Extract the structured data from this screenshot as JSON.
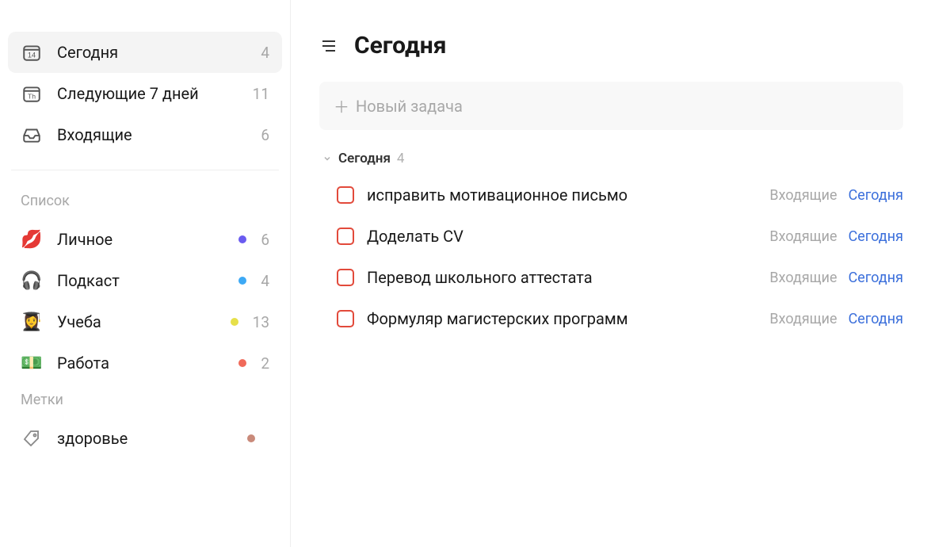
{
  "sidebar": {
    "smart": [
      {
        "icon": "calendar-today",
        "label": "Сегодня",
        "count": 4,
        "selected": true
      },
      {
        "icon": "calendar-week",
        "label": "Следующие 7 дней",
        "count": 11,
        "selected": false
      },
      {
        "icon": "inbox",
        "label": "Входящие",
        "count": 6,
        "selected": false
      }
    ],
    "lists_header": "Список",
    "lists": [
      {
        "emoji": "💋",
        "label": "Личное",
        "dot": "#6a5bf0",
        "count": 6
      },
      {
        "emoji": "🎧",
        "label": "Подкаст",
        "dot": "#3da9f5",
        "count": 4
      },
      {
        "emoji": "👩‍🎓",
        "label": "Учеба",
        "dot": "#e6e04a",
        "count": 13
      },
      {
        "emoji": "💵",
        "label": "Работа",
        "dot": "#f06a5a",
        "count": 2
      }
    ],
    "tags_header": "Метки",
    "tags": [
      {
        "icon": "tag",
        "label": "здоровье",
        "dot": "#c98a7a"
      }
    ]
  },
  "main": {
    "title": "Сегодня",
    "new_task_placeholder": "Новый задача",
    "group": {
      "label": "Сегодня",
      "count": 4
    },
    "tasks": [
      {
        "title": "исправить мотивационное письмо",
        "list": "Входящие",
        "date": "Сегодня"
      },
      {
        "title": "Доделать CV",
        "list": "Входящие",
        "date": "Сегодня"
      },
      {
        "title": "Перевод школьного аттестата",
        "list": "Входящие",
        "date": "Сегодня"
      },
      {
        "title": "Формуляр магистерских программ",
        "list": "Входящие",
        "date": "Сегодня"
      }
    ]
  }
}
